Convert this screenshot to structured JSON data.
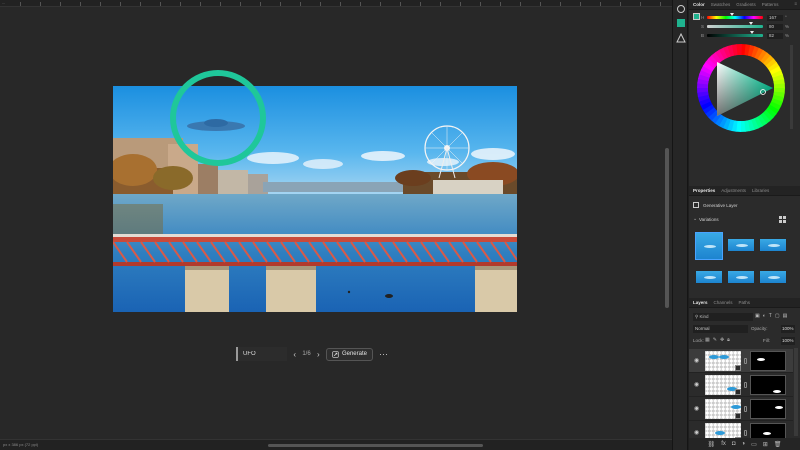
{
  "document": {
    "tab_label": "..."
  },
  "task_bar": {
    "prompt_value": "UFO",
    "prev_label": "‹",
    "next_label": "›",
    "variation_counter": "1/6",
    "generate_label": "Generate",
    "more_label": "···"
  },
  "status_bar": {
    "text": "px x 386 px (72 ppi)"
  },
  "color_panel": {
    "tabs": [
      "Color",
      "Swatches",
      "Gradients",
      "Patterns"
    ],
    "active_tab": "Color",
    "foreground_color": "#1fb38f",
    "sliders": [
      {
        "letter": "H",
        "value": "167",
        "unit": "°",
        "position": 0.46
      },
      {
        "letter": "S",
        "value": "80",
        "unit": "%",
        "position": 0.8
      },
      {
        "letter": "B",
        "value": "82",
        "unit": "%",
        "position": 0.82
      }
    ]
  },
  "properties_panel": {
    "tabs": [
      "Properties",
      "Adjustments",
      "Libraries"
    ],
    "active_tab": "Properties",
    "layer_type": "Generative Layer",
    "variations_label": "Variations",
    "variation_count": 6
  },
  "layers_panel": {
    "tabs": [
      "Layers",
      "Channels",
      "Paths"
    ],
    "active_tab": "Layers",
    "filter_kind": "Kind",
    "blend_mode": "Normal",
    "opacity_label": "Opacity:",
    "opacity_value": "100%",
    "lock_label": "Lock:",
    "fill_label": "Fill:",
    "fill_value": "100%",
    "layer_count": 4
  },
  "colors": {
    "accent_highlight": "#1fc79a",
    "panel_bg": "#2b2b2b",
    "canvas_bg": "#282828"
  }
}
